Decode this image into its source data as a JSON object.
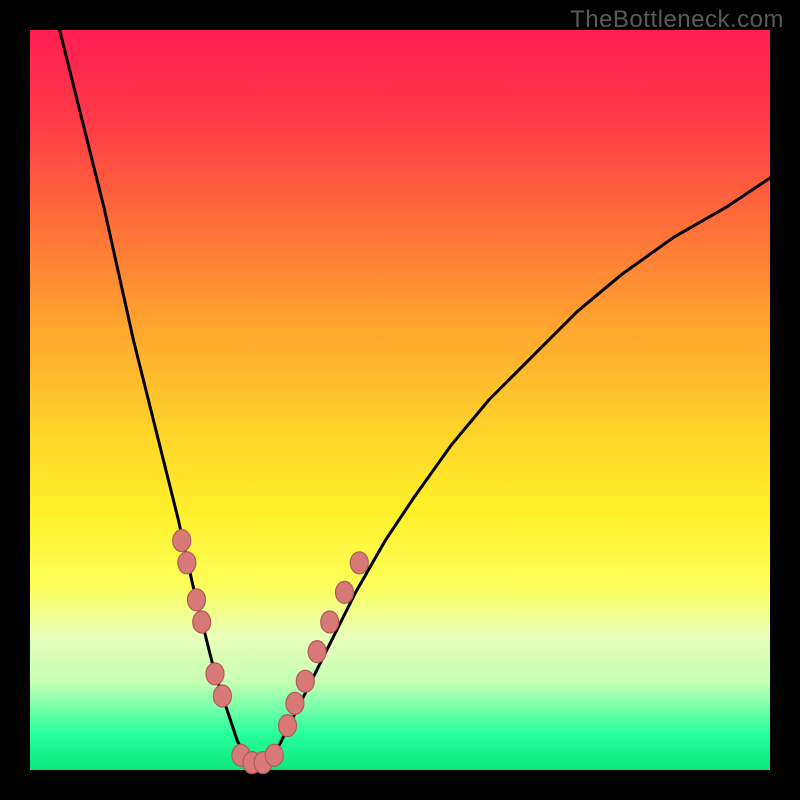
{
  "watermark": "TheBottleneck.com",
  "chart_data": {
    "type": "line",
    "title": "",
    "xlabel": "",
    "ylabel": "",
    "xlim": [
      0,
      100
    ],
    "ylim": [
      0,
      100
    ],
    "legend": false,
    "grid": false,
    "series": [
      {
        "name": "left-curve",
        "x": [
          4,
          6,
          8,
          10,
          12,
          14,
          16,
          18,
          20,
          22,
          23,
          24,
          25,
          26,
          27,
          28,
          29.5
        ],
        "values": [
          100,
          92,
          84,
          76,
          67,
          58,
          50,
          42,
          34,
          25,
          21,
          17,
          13,
          10,
          7,
          4,
          1
        ]
      },
      {
        "name": "right-curve",
        "x": [
          32.5,
          34,
          36,
          38,
          41,
          44,
          48,
          52,
          57,
          62,
          68,
          74,
          80,
          87,
          94,
          100
        ],
        "values": [
          1,
          4,
          8,
          12,
          18,
          24,
          31,
          37,
          44,
          50,
          56,
          62,
          67,
          72,
          76,
          80
        ]
      },
      {
        "name": "valley-floor",
        "x": [
          29.5,
          32.5
        ],
        "values": [
          1,
          1
        ]
      }
    ],
    "markers": [
      {
        "series": "left-curve",
        "x": 20.5,
        "y": 31
      },
      {
        "series": "left-curve",
        "x": 21.2,
        "y": 28
      },
      {
        "series": "left-curve",
        "x": 22.5,
        "y": 23
      },
      {
        "series": "left-curve",
        "x": 23.2,
        "y": 20
      },
      {
        "series": "left-curve",
        "x": 25.0,
        "y": 13
      },
      {
        "series": "left-curve",
        "x": 26.0,
        "y": 10
      },
      {
        "series": "valley-floor",
        "x": 28.5,
        "y": 2
      },
      {
        "series": "valley-floor",
        "x": 30.0,
        "y": 1
      },
      {
        "series": "valley-floor",
        "x": 31.5,
        "y": 1
      },
      {
        "series": "valley-floor",
        "x": 33.0,
        "y": 2
      },
      {
        "series": "right-curve",
        "x": 34.8,
        "y": 6
      },
      {
        "series": "right-curve",
        "x": 35.8,
        "y": 9
      },
      {
        "series": "right-curve",
        "x": 37.2,
        "y": 12
      },
      {
        "series": "right-curve",
        "x": 38.8,
        "y": 16
      },
      {
        "series": "right-curve",
        "x": 40.5,
        "y": 20
      },
      {
        "series": "right-curve",
        "x": 42.5,
        "y": 24
      },
      {
        "series": "right-curve",
        "x": 44.5,
        "y": 28
      }
    ],
    "colors": {
      "curve": "#000000",
      "marker_fill": "#d77a77",
      "marker_stroke": "#b05a58",
      "gradient_top": "#ff1d52",
      "gradient_bottom": "#09e77c"
    }
  }
}
